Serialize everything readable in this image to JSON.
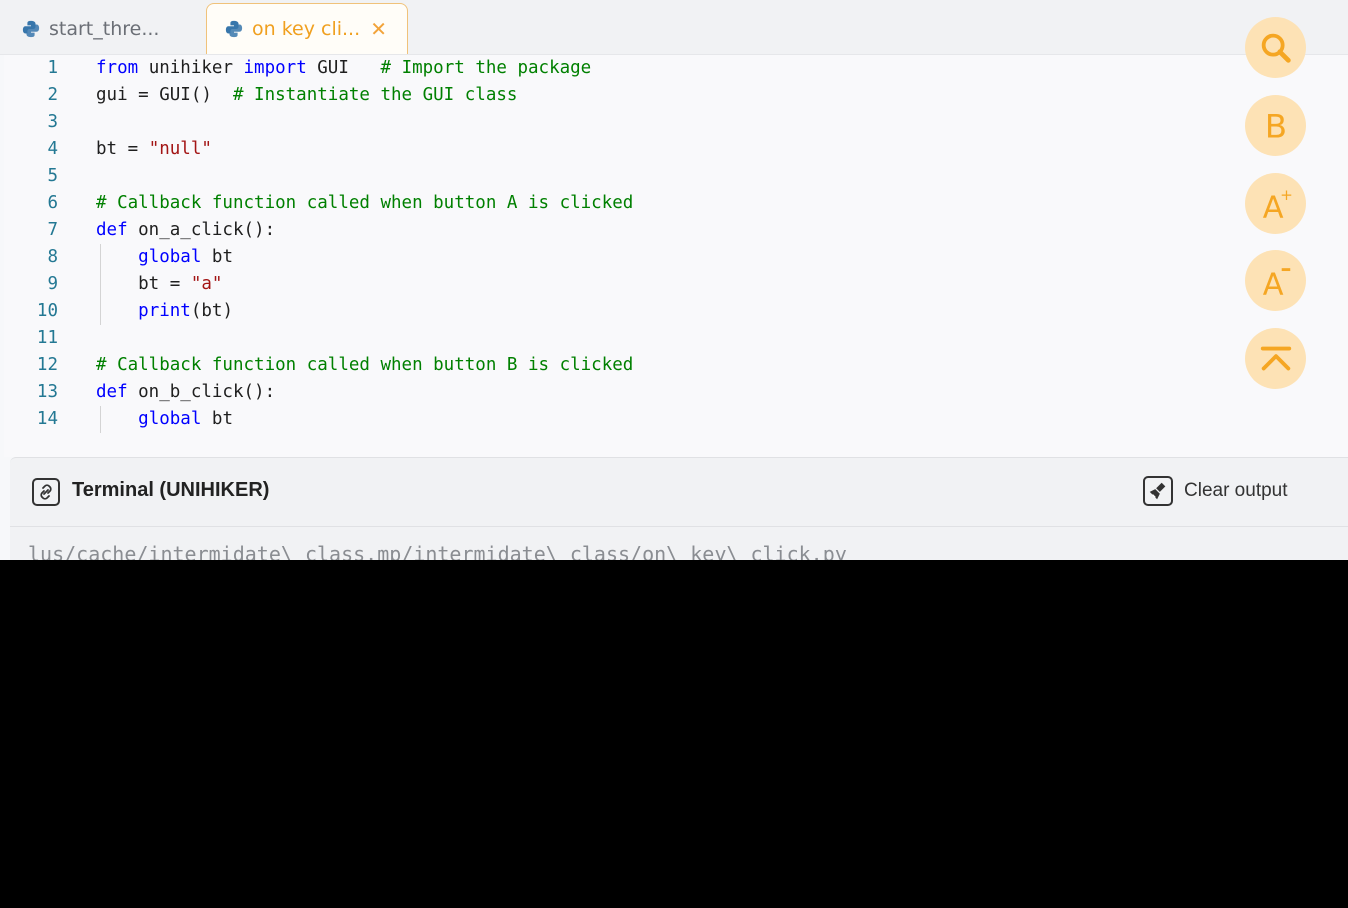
{
  "tabs": [
    {
      "label": "start_thre...",
      "active": false
    },
    {
      "label": "on key cli...",
      "active": true,
      "close_icon": "close-icon"
    }
  ],
  "editor": {
    "lines": [
      {
        "n": "1",
        "tokens": [
          {
            "t": "from",
            "c": "kw"
          },
          {
            "t": " unihiker ",
            "c": ""
          },
          {
            "t": "import",
            "c": "kw"
          },
          {
            "t": " GUI   ",
            "c": ""
          },
          {
            "t": "# Import the package",
            "c": "cm"
          }
        ]
      },
      {
        "n": "2",
        "tokens": [
          {
            "t": "gui = GUI()  ",
            "c": ""
          },
          {
            "t": "# Instantiate the GUI class",
            "c": "cm"
          }
        ]
      },
      {
        "n": "3",
        "tokens": []
      },
      {
        "n": "4",
        "tokens": [
          {
            "t": "bt = ",
            "c": ""
          },
          {
            "t": "\"null\"",
            "c": "str"
          }
        ]
      },
      {
        "n": "5",
        "tokens": []
      },
      {
        "n": "6",
        "tokens": [
          {
            "t": "# Callback function called when button A is clicked",
            "c": "cm"
          }
        ]
      },
      {
        "n": "7",
        "tokens": [
          {
            "t": "def",
            "c": "kw"
          },
          {
            "t": " on_a_click():",
            "c": ""
          }
        ]
      },
      {
        "n": "8",
        "tokens": [
          {
            "t": "    ",
            "c": ""
          },
          {
            "t": "global",
            "c": "kw2"
          },
          {
            "t": " bt",
            "c": ""
          }
        ]
      },
      {
        "n": "9",
        "tokens": [
          {
            "t": "    bt = ",
            "c": ""
          },
          {
            "t": "\"a\"",
            "c": "str"
          }
        ]
      },
      {
        "n": "10",
        "tokens": [
          {
            "t": "    ",
            "c": ""
          },
          {
            "t": "print",
            "c": "kw2"
          },
          {
            "t": "(bt)",
            "c": ""
          }
        ]
      },
      {
        "n": "11",
        "tokens": []
      },
      {
        "n": "12",
        "tokens": [
          {
            "t": "# Callback function called when button B is clicked",
            "c": "cm"
          }
        ]
      },
      {
        "n": "13",
        "tokens": [
          {
            "t": "def",
            "c": "kw"
          },
          {
            "t": " on_b_click():",
            "c": ""
          }
        ]
      },
      {
        "n": "14",
        "tokens": [
          {
            "t": "    ",
            "c": ""
          },
          {
            "t": "global",
            "c": "kw2"
          },
          {
            "t": " bt",
            "c": ""
          }
        ]
      }
    ]
  },
  "floating_buttons": [
    {
      "name": "search-icon"
    },
    {
      "name": "b-icon"
    },
    {
      "name": "font-increase-icon"
    },
    {
      "name": "font-decrease-icon"
    },
    {
      "name": "scroll-top-icon"
    }
  ],
  "terminal": {
    "title": "Terminal (UNIHIKER)",
    "clear_label": "Clear output",
    "output": "lus/cache/intermidate\\ class.mp/intermidate\\ class/on\\ key\\ click.py"
  },
  "colors": {
    "accent": "#f0a020",
    "fab_bg": "#fde2b5",
    "comment": "#008000",
    "keyword": "#0000ff",
    "string": "#a31515",
    "line_number": "#237893"
  }
}
